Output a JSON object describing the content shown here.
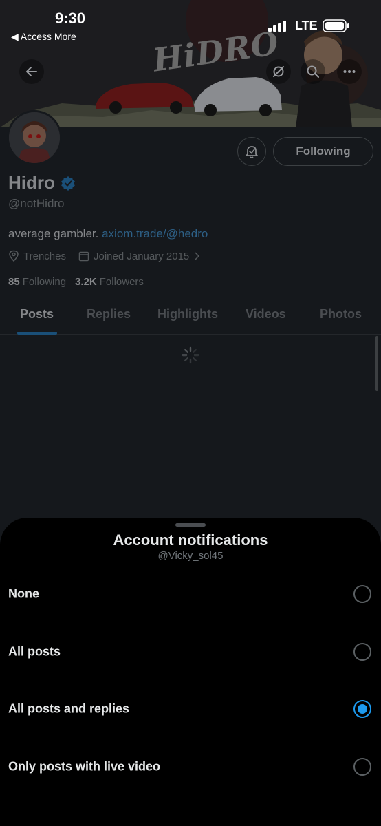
{
  "status_bar": {
    "time": "9:30",
    "back_app": "◀ Access More",
    "network": "LTE"
  },
  "banner": {
    "title": "HiDRO"
  },
  "profile": {
    "follow_state": "Following",
    "name": "Hidro",
    "handle": "@notHidro",
    "bio_text": "average gambler. ",
    "bio_link": "axiom.trade/@hedro",
    "location": "Trenches",
    "joined": "Joined January 2015",
    "following_count": "85",
    "following_label": "Following",
    "followers_count": "3.2K",
    "followers_label": "Followers"
  },
  "tabs": [
    "Posts",
    "Replies",
    "Highlights",
    "Videos",
    "Photos"
  ],
  "sheet": {
    "title": "Account notifications",
    "subtitle": "@Vicky_sol45",
    "options": [
      {
        "label": "None",
        "selected": false
      },
      {
        "label": "All posts",
        "selected": false
      },
      {
        "label": "All posts and replies",
        "selected": true
      },
      {
        "label": "Only posts with live video",
        "selected": false
      }
    ]
  },
  "colors": {
    "accent": "#1d9bf0",
    "sheet_bg": "#000000",
    "dim_bg": "#15181c"
  }
}
